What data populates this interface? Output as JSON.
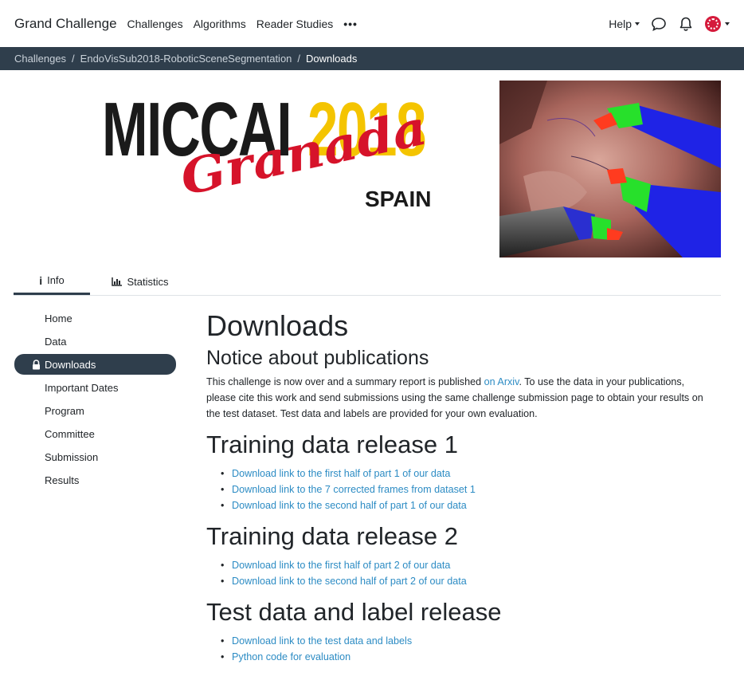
{
  "navbar": {
    "brand": "Grand Challenge",
    "links": [
      "Challenges",
      "Algorithms",
      "Reader Studies"
    ],
    "more": "•••",
    "help": "Help",
    "icons": [
      "chat-icon",
      "bell-icon",
      "avatar"
    ]
  },
  "breadcrumb": [
    "Challenges",
    "EndoVisSub2018-RoboticSceneSegmentation",
    "Downloads"
  ],
  "banner": {
    "logo_main": "MICCAI",
    "logo_year": "2018",
    "logo_city": "Granada",
    "logo_country": "SPAIN",
    "colors": {
      "year": "#f4c400",
      "city": "#d6132a"
    }
  },
  "tabs": [
    {
      "label": "Info",
      "icon": "info-icon",
      "active": true
    },
    {
      "label": "Statistics",
      "icon": "bar-chart-icon",
      "active": false
    }
  ],
  "sidebar": {
    "items": [
      "Home",
      "Data",
      "Downloads",
      "Important Dates",
      "Program",
      "Committee",
      "Submission",
      "Results"
    ],
    "active": "Downloads"
  },
  "main": {
    "title": "Downloads",
    "notice_heading": "Notice about publications",
    "notice_pre": "This challenge is now over and a summary report is published ",
    "notice_link": "on Arxiv",
    "notice_post": ". To use the data in your publications, please cite this work and send submissions using the same challenge submission page to obtain your results on the test dataset. Test data and labels are provided for your own evaluation.",
    "sections": [
      {
        "heading": "Training data release 1",
        "links": [
          "Download link to the first half of part 1 of our data",
          "Download link to the 7 corrected frames from dataset 1",
          "Download link to the second half of part 1 of our data"
        ]
      },
      {
        "heading": "Training data release 2",
        "links": [
          "Download link to the first half of part 2 of our data",
          "Download link to the second half of part 2 of our data"
        ]
      },
      {
        "heading": "Test data and label release",
        "links": [
          "Download link to the test data and labels",
          "Python code for evaluation"
        ]
      }
    ]
  },
  "theme": {
    "dark": "#2f3e4c",
    "link": "#2d8cc4"
  }
}
